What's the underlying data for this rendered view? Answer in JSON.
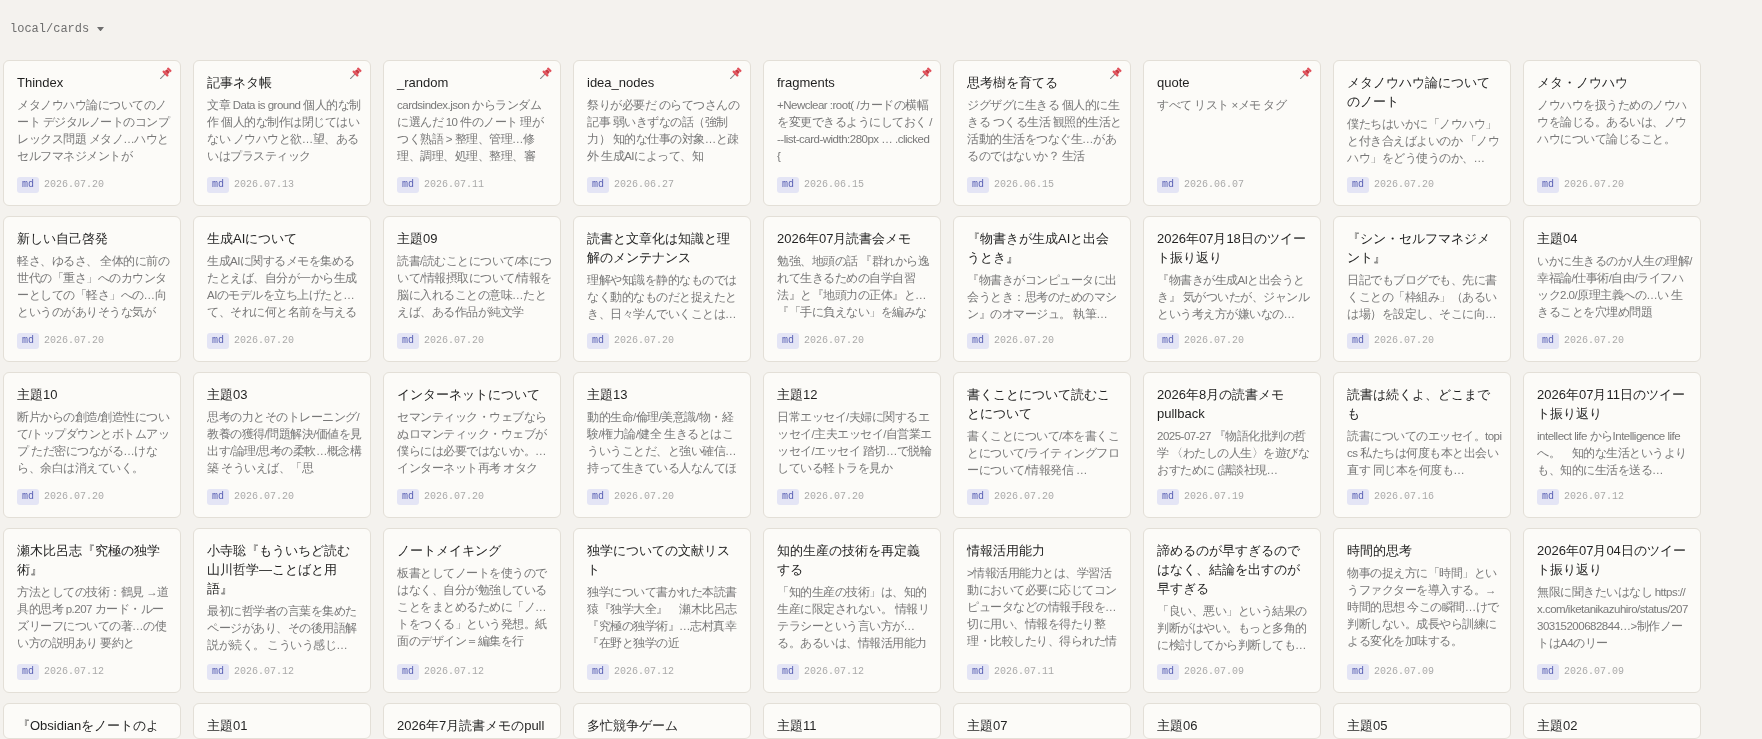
{
  "header": {
    "path": "local/cards"
  },
  "cards": [
    {
      "title": "Thindex",
      "pinned": true,
      "excerpt": "メタノウハウ論についてのノート デジタルノートのコンプレックス問題 メタノ…ハウとセルフマネジメントが",
      "format": "md",
      "date": "2026.07.20"
    },
    {
      "title": "記事ネタ帳",
      "pinned": true,
      "excerpt": "文章 Data is ground 個人的な制作 個人的な制作は閉じてはいない ノウハウと欲…望、あるいはプラスティック",
      "format": "md",
      "date": "2026.07.13"
    },
    {
      "title": "_random",
      "pinned": true,
      "excerpt": "cardsindex.json からランダムに選んだ 10 件のノート 理がつく熟語 > 整理、管理…修理、調理、処理、整理、審",
      "format": "md",
      "date": "2026.07.11"
    },
    {
      "title": "idea_nodes",
      "pinned": true,
      "excerpt": "祭りが必要だ のらてつさんの記事 弱いきずなの話（強制力） 知的な仕事の対象…と疎外 生成AIによって、知",
      "format": "md",
      "date": "2026.06.27"
    },
    {
      "title": "fragments",
      "pinned": true,
      "excerpt": "+Newclear :root( /カードの横幅を変更できるようにしておく / --list-card-width:280px … .clicked {",
      "format": "md",
      "date": "2026.06.15"
    },
    {
      "title": "思考樹を育てる",
      "pinned": true,
      "excerpt": "ジグザグに生きる 個人的に生きる つくる生活 観照的生活と活動的生活をつなぐ生…があるのではないか？ 生活",
      "format": "md",
      "date": "2026.06.15"
    },
    {
      "title": "quote",
      "pinned": true,
      "excerpt": "すべて リスト ×メモ タグ",
      "format": "md",
      "date": "2026.06.07"
    },
    {
      "title": "メタノウハウ論についてのノート",
      "pinned": false,
      "excerpt": "僕たちはいかに「ノウハウ」と付き合えばよいのか 「ノウハウ」をどう使うのか、…",
      "format": "md",
      "date": "2026.07.20"
    },
    {
      "title": "メタ・ノウハウ",
      "pinned": false,
      "excerpt": "ノウハウを扱うためのノウハウを論じる。あるいは、ノウハウについて論じること。",
      "format": "md",
      "date": "2026.07.20"
    },
    {
      "title": "新しい自己啓発",
      "pinned": false,
      "excerpt": "軽さ、ゆるさ、 全体的に前の世代の「重さ」へのカウンターとしての「軽さ」への…向というのがありそうな気が",
      "format": "md",
      "date": "2026.07.20"
    },
    {
      "title": "生成AIについて",
      "pinned": false,
      "excerpt": "生成AIに関するメモを集めるたとえば、自分が一から生成AIのモデルを立ち上げたと…て、それに何と名前を与える",
      "format": "md",
      "date": "2026.07.20"
    },
    {
      "title": "主題09",
      "pinned": false,
      "excerpt": "読書/読むことについて/本について/情報摂取について/情報を脳に入れることの意味…たとえば、ある作品が純文学",
      "format": "md",
      "date": "2026.07.20"
    },
    {
      "title": "読書と文章化は知識と理解のメンテナンス",
      "pinned": false,
      "excerpt": "理解や知識を静的なものではなく動的なものだと捉えたとき、日々学んでいくことは…",
      "format": "md",
      "date": "2026.07.20"
    },
    {
      "title": "2026年07月読書会メモ",
      "pinned": false,
      "excerpt": "勉強、地頭の話 『群れから逸れて生きるための自学自習法』と『地頭力の正体』と…『「手に負えない」を編みな",
      "format": "md",
      "date": "2026.07.20"
    },
    {
      "title": "『物書きが生成AIと出会うとき』",
      "pinned": false,
      "excerpt": "『物書きがコンピュータに出会うとき：思考のためのマシン』のオマージュ。 執筆…",
      "format": "md",
      "date": "2026.07.20"
    },
    {
      "title": "2026年07月18日のツイート振り返り",
      "pinned": false,
      "excerpt": "『物書きが生成AIと出会うとき』 気がついたが、ジャンルという考え方が嫌いなの…",
      "format": "md",
      "date": "2026.07.20"
    },
    {
      "title": "『シン・セルフマネジメント』",
      "pinned": false,
      "excerpt": "日記でもブログでも、先に書くことの「枠組み」（あるいは場）を設定し、そこに向…",
      "format": "md",
      "date": "2026.07.20"
    },
    {
      "title": "主題04",
      "pinned": false,
      "excerpt": "いかに生きるのか/人生の理解/幸福論/仕事術/自由/ライフハック2.0/原理主義への…い 生きることを穴埋め問題",
      "format": "md",
      "date": "2026.07.20"
    },
    {
      "title": "主題10",
      "pinned": false,
      "excerpt": "断片からの創造/創造性について/トップダウンとボトムアップ ただ密につながる…けなら、余白は消えていく。",
      "format": "md",
      "date": "2026.07.20"
    },
    {
      "title": "主題03",
      "pinned": false,
      "excerpt": "思考の力とそのトレーニング/教養の獲得/問題解決/価値を見出す/論理/思考の柔軟…概念構築 そういえば、「思",
      "format": "md",
      "date": "2026.07.20"
    },
    {
      "title": "インターネットについて",
      "pinned": false,
      "excerpt": "セマンティック・ウェブならぬロマンティック・ウェブが僕らには必要ではないか。…インターネット再考 オタク",
      "format": "md",
      "date": "2026.07.20"
    },
    {
      "title": "主題13",
      "pinned": false,
      "excerpt": "動的生命/倫理/美意識/物・経験/権力論/健全 生きるとはこういうことだ、と強い確信…持って生きている人なんてほ",
      "format": "md",
      "date": "2026.07.20"
    },
    {
      "title": "主題12",
      "pinned": false,
      "excerpt": "日常エッセイ/夫婦に関するエッセイ/主夫エッセイ/自営業エッセイ/エッセイ 踏切…で脱輪している軽トラを見か",
      "format": "md",
      "date": "2026.07.20"
    },
    {
      "title": "書くことについて読むことについて",
      "pinned": false,
      "excerpt": "書くことについて/本を書くことについて/ライティングフローについて/情報発信 …",
      "format": "md",
      "date": "2026.07.20"
    },
    {
      "title": "2026年8月の読書メモpullback",
      "pinned": false,
      "excerpt": "2025-07-27 『物語化批判の哲学 〈わたしの人生〉を遊びなおすために (講談社現…",
      "format": "md",
      "date": "2026.07.19"
    },
    {
      "title": "読書は続くよ、どこまでも",
      "pinned": false,
      "excerpt": "読書についてのエッセイ。topics 私たちは何度も本と出会い直す 同じ本を何度も…",
      "format": "md",
      "date": "2026.07.16"
    },
    {
      "title": "2026年07月11日のツイート振り返り",
      "pinned": false,
      "excerpt": "intellect life からIntelligence lifeへ。　知的な生活というよりも、知的に生活を送る…",
      "format": "md",
      "date": "2026.07.12"
    },
    {
      "title": "瀬木比呂志『究極の独学術』",
      "pinned": false,
      "excerpt": "方法としての技術：鶴見 →道具的思考 p.207 カード・ルーズリーフについての著…の使い方の説明あり 要約と",
      "format": "md",
      "date": "2026.07.12"
    },
    {
      "title": "小寺聡『もういちど読む山川哲学―ことばと用語』",
      "pinned": false,
      "excerpt": "最初に哲学者の言葉を集めたページがあり、その後用語解説が続く。 こういう感じ…",
      "format": "md",
      "date": "2026.07.12"
    },
    {
      "title": "ノートメイキング",
      "pinned": false,
      "excerpt": "板書としてノートを使うのではなく、自分が勉強していることをまとめるために「ノ…トをつくる」という発想。紙面のデザイン＝編集を行",
      "format": "md",
      "date": "2026.07.12"
    },
    {
      "title": "独学についての文献リスト",
      "pinned": false,
      "excerpt": "独学について書かれた本読書猿『独学大全』　瀬木比呂志『究極の独学術』…志村真幸『在野と独学の近",
      "format": "md",
      "date": "2026.07.12"
    },
    {
      "title": "知的生産の技術を再定義する",
      "pinned": false,
      "excerpt": "「知的生産の技術」は、知的生産に限定されない。 情報リテラシーという言い方が…る。あるいは、情報活用能力",
      "format": "md",
      "date": "2026.07.12"
    },
    {
      "title": "情報活用能力",
      "pinned": false,
      "excerpt": ">情報活用能力とは、学習活動において必要に応じてコンピュータなどの情報手段を…切に用い、情報を得たり整理・比較したり、得られた情",
      "format": "md",
      "date": "2026.07.11"
    },
    {
      "title": "諦めるのが早すぎるのではなく、結論を出すのが早すぎる",
      "pinned": false,
      "excerpt": "「良い、悪い」という結果の判断がはやい。もっと多角的に検討してから判断しても…",
      "format": "md",
      "date": "2026.07.09"
    },
    {
      "title": "時間的思考",
      "pinned": false,
      "excerpt": "物事の捉え方に「時間」というファクターを導入する。→時間的思想 今この瞬間…けで判断しない。成長やら訓練による変化を加味する。",
      "format": "md",
      "date": "2026.07.09"
    },
    {
      "title": "2026年07月04日のツイート振り返り",
      "pinned": false,
      "excerpt": "無限に聞きたいはなし https://x.com/iketanikazuhiro/status/20730315200682844…>制作ノートはA4のリー",
      "format": "md",
      "date": "2026.07.09"
    },
    {
      "title": "『Obsidianをノートのよ",
      "pinned": false
    },
    {
      "title": "主題01",
      "pinned": false
    },
    {
      "title": "2026年7月読書メモのpull",
      "pinned": false
    },
    {
      "title": "多忙競争ゲーム",
      "pinned": false
    },
    {
      "title": "主題11",
      "pinned": false
    },
    {
      "title": "主題07",
      "pinned": false
    },
    {
      "title": "主題06",
      "pinned": false
    },
    {
      "title": "主題05",
      "pinned": false
    },
    {
      "title": "主題02",
      "pinned": false
    }
  ]
}
